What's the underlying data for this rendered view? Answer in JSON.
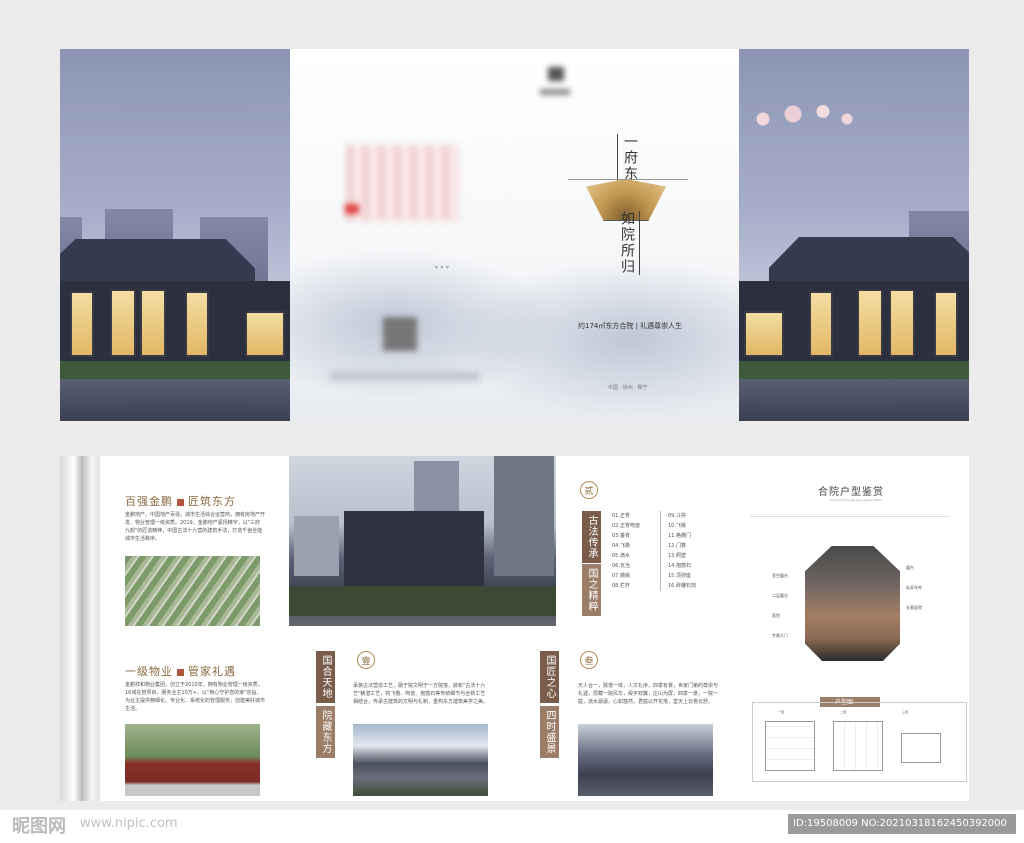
{
  "cover": {
    "tagline_top": "一府东方",
    "tagline_bottom": "如院所归",
    "slogan": "约174㎡东方合院 | 礼遇尊崇人生",
    "location": "中国 · 徐州 · 睢宁"
  },
  "intro": {
    "title_a": "百强金鹏",
    "title_b": "匠筑东方",
    "body": "金鹏地产，中国地产百强，城市生活综合运营商，拥有房地产开发、物业管理一级资质。2019，金鹏地产紧扬精宇，以\"三府九颜\"的匠造精神，中国古法十六营的建筑手法，打造千亩全能城市生活秩序。",
    "service_a": "一级物业",
    "service_b": "管家礼遇",
    "service_body": "金鹏祥和物业集团，创立于2010年，拥有物业管理一级资质，16城在管项目，服务业主10万+，以\"用心守护您的家\"宗旨，为业主提供精细化、专业化、系统化的管理服务，创建美好城市生活。"
  },
  "techniques": {
    "seal": "贰",
    "tag_a": "古法传承",
    "tag_b": "国之精粹",
    "items_left": [
      "01.正脊",
      "02.正脊吻兽",
      "03.垂脊",
      "04.飞檐",
      "05.滴水",
      "06.瓦当",
      "07.檐椽",
      "08.栏杆"
    ],
    "items_right": [
      "09.斗拱",
      "10.飞椽",
      "11.格栅门",
      "12.门簪",
      "13.照壁",
      "14.抱鼓石",
      "15.须弥座",
      "16.砖雕石刻"
    ]
  },
  "section_one": {
    "seal": "壹",
    "tag_a": "国合天地",
    "tag_b": "院藏东方",
    "body": "承袭古法营造工艺，融于院文明于一方院落，掀新\"古法十六艺\"精湛工艺，将飞檐、吻兽、抱鼓石等传统细节与全新工艺相结合，传承古建筑的文明与礼制，重构东方建筑美学之美。"
  },
  "section_three": {
    "seal": "叁",
    "tag_a": "国匠之心",
    "tag_b": "四时盛景",
    "body": "天人合一，院落一体，人文礼序，四季有景，世家门第的尊崇与礼遇，层藏一院风华，殿宇双翼，庄山为屏，四季一景，一院一庭，流水潺潺，心如悠然，君庭以开花落，堂天上云卷云舒。"
  },
  "floorplan": {
    "title": "合院户型鉴赏",
    "subtitle": "Courtyard house type appreciation",
    "labels_left": [
      "室空露台",
      "二层露台",
      "庭院",
      "专属大门"
    ],
    "labels_right": [
      "露台",
      "私家车库",
      "长廊庭院"
    ],
    "plan_title": "户型图",
    "plan_floors": [
      "一层",
      "二层",
      "三层"
    ]
  },
  "watermark": {
    "logo": "昵图网",
    "url": "www.nipic.com",
    "id": "ID:19508009 NO:20210318162450392000"
  }
}
